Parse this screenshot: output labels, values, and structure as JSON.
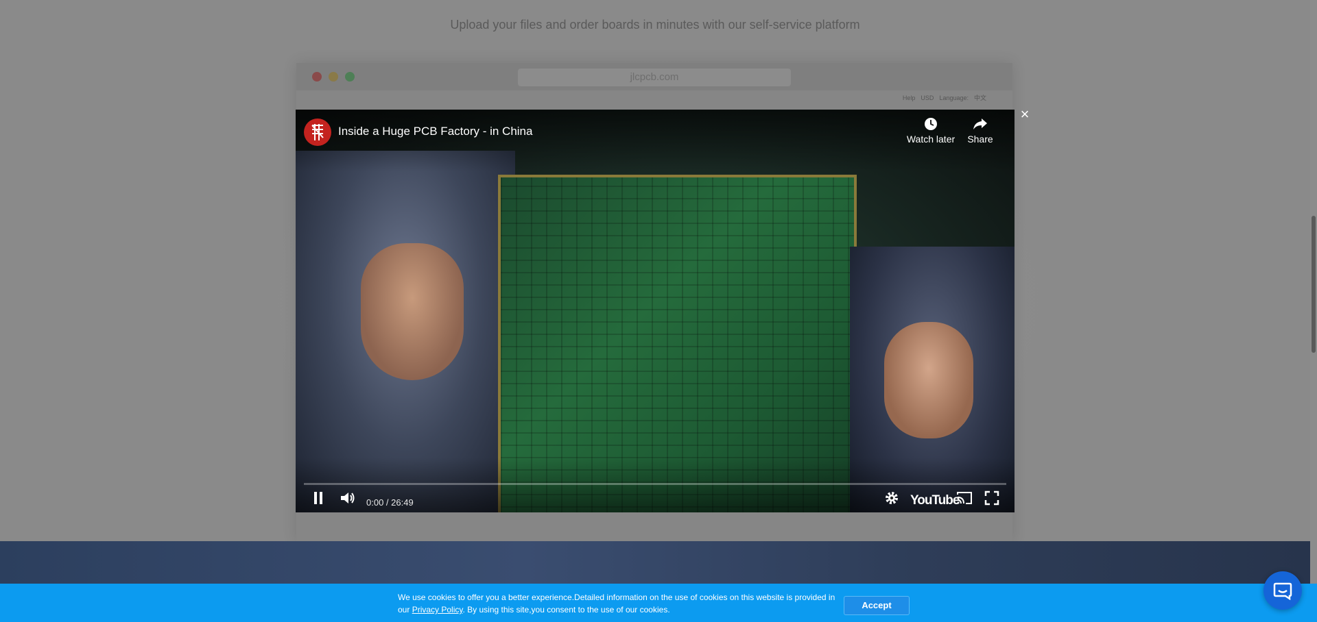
{
  "background_page": {
    "subtitle": "Upload your files and order boards in minutes with our self-service platform",
    "browser_mock": {
      "url": "jlcpcb.com",
      "top_links": {
        "help": "Help",
        "currency": "USD",
        "language": "Language:",
        "language_value": "中文"
      }
    }
  },
  "video_modal": {
    "title": "Inside a Huge PCB Factory - in China",
    "watch_later_label": "Watch later",
    "share_label": "Share",
    "time": "0:00 / 26:49",
    "progress": 0,
    "brand": "YouTube",
    "close_label": "×",
    "icons": [
      "channel-avatar",
      "clock-icon",
      "share-icon",
      "pause-icon",
      "volume-icon",
      "settings-icon",
      "cast-icon",
      "fullscreen-icon"
    ]
  },
  "cookie_banner": {
    "text_part1": "We use cookies to offer you a better experience.Detailed information on the use of cookies on this website is provided in our ",
    "link_text": "Privacy Policy",
    "text_part2": ". By using this site,you consent to the use of our cookies.",
    "accept_label": "Accept",
    "color": "#0c9bf0"
  },
  "chat_widget": {
    "icon": "chat-icon",
    "color": "#1565d8"
  }
}
